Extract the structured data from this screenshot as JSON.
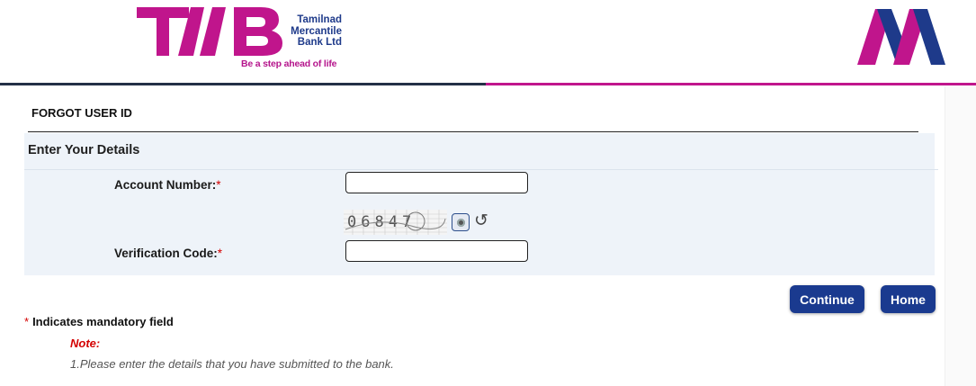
{
  "brand": {
    "logo_initials": "TMB",
    "bank_name_lines": [
      "Tamilnad",
      "Mercantile",
      "Bank Ltd"
    ],
    "tagline": "Be a step ahead of life",
    "colors": {
      "magenta": "#c0158c",
      "navy": "#1e3a8a",
      "button": "#1a3a8f"
    }
  },
  "page": {
    "title": "FORGOT USER ID",
    "section_heading": "Enter Your Details"
  },
  "form": {
    "account_number": {
      "label": "Account Number:",
      "required_mark": "*",
      "value": ""
    },
    "captcha": {
      "text": "06847",
      "audio_icon": "audio-icon",
      "refresh_icon": "refresh-icon",
      "refresh_glyph": "↺"
    },
    "verification_code": {
      "label": "Verification Code:",
      "required_mark": "*",
      "value": ""
    }
  },
  "actions": {
    "continue_label": "Continue",
    "home_label": "Home"
  },
  "footer": {
    "mandatory_mark": "*",
    "mandatory_text": "Indicates mandatory field",
    "note_title": "Note:",
    "note_text": "1.Please enter the details that you have submitted to the bank."
  }
}
